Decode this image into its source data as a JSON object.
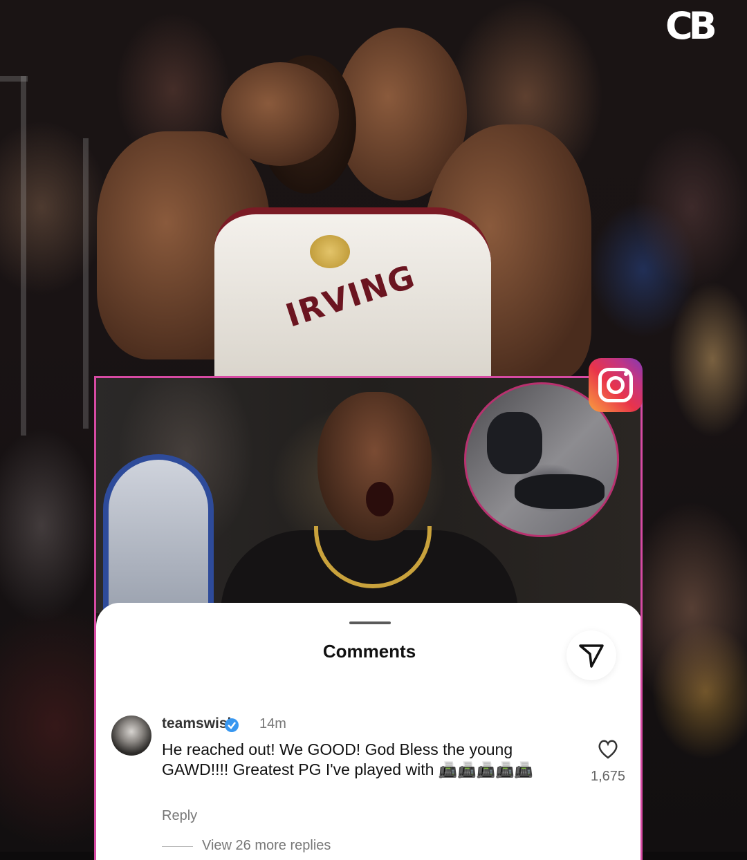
{
  "brand": {
    "logo_text": "CB"
  },
  "hug_photo": {
    "jersey_name": "IRVING"
  },
  "instagram": {
    "icon": "instagram-icon",
    "comments_sheet": {
      "title": "Comments",
      "send_icon": "send-icon",
      "comment": {
        "username": "teamswish",
        "verified": true,
        "time": "14m",
        "text": "He reached out! We GOOD! God Bless the young GAWD!!!! Greatest PG I've played with",
        "emojis": "📠📠📠📠📠",
        "reply_label": "Reply",
        "like_icon": "heart-icon",
        "likes": "1,675"
      },
      "view_more_label": "View 26 more replies"
    }
  }
}
